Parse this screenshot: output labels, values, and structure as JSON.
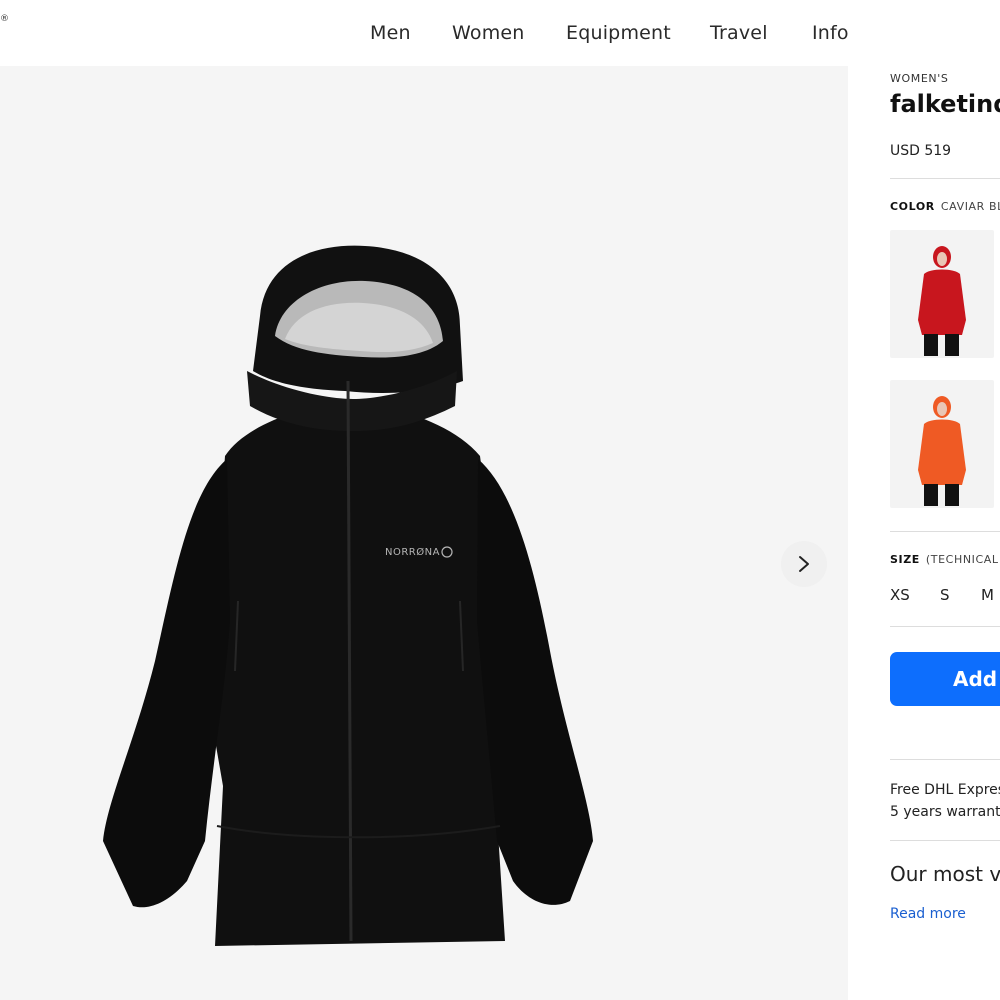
{
  "header": {
    "logo_fragment": "®",
    "nav": [
      {
        "label": "Men"
      },
      {
        "label": "Women"
      },
      {
        "label": "Equipment"
      },
      {
        "label": "Travel"
      },
      {
        "label": "Info"
      }
    ]
  },
  "gallery": {
    "brand_mark": "NORRØNA"
  },
  "product": {
    "category": "WOMEN'S",
    "title": "falketind",
    "price": "USD 519",
    "color_label": "COLOR",
    "color_value": "CAVIAR BL",
    "swatches": [
      {
        "name": "red",
        "color": "#c8161e"
      },
      {
        "name": "orange",
        "color": "#ef5a24"
      }
    ],
    "size_label": "SIZE",
    "size_note": "(TECHNICAL",
    "sizes": [
      "XS",
      "S",
      "M"
    ],
    "add_button": "Add t",
    "shipping": "Free DHL Expres",
    "warranty": "5 years warrant",
    "description": "Our most ve",
    "read_more": "Read more"
  },
  "colors": {
    "accent": "#0d6efd",
    "gallery_bg": "#f5f5f5",
    "jacket": "#101010",
    "link": "#1a5fd0"
  }
}
